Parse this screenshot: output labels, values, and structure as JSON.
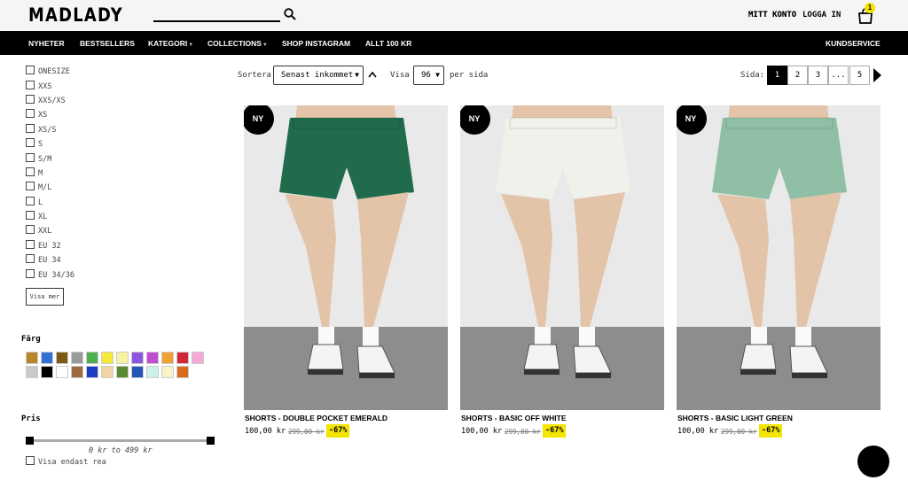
{
  "header": {
    "logo": "MADLADY",
    "account": "MITT KONTO",
    "login": "LOGGA IN",
    "cart_count": "1"
  },
  "nav": {
    "items": [
      "NYHETER",
      "BESTSELLERS",
      "KATEGORI",
      "COLLECTIONS",
      "SHOP INSTAGRAM",
      "ALLT 100 KR"
    ],
    "service": "KUNDSERVICE"
  },
  "sidebar": {
    "sizes": [
      "ONESIZE",
      "XXS",
      "XXS/XS",
      "XS",
      "XS/S",
      "S",
      "S/M",
      "M",
      "M/L",
      "L",
      "XL",
      "XXL",
      "EU 32",
      "EU 34",
      "EU 34/36"
    ],
    "more": "Visa mer",
    "color_heading": "Färg",
    "colors": [
      "#b8862b",
      "#2f6fd6",
      "#7a5a12",
      "#9a9a9a",
      "#4caf50",
      "#f5ea3a",
      "#f7f2a0",
      "#8b55e0",
      "#c04ccf",
      "#f0a133",
      "#d2283c",
      "#f5a8d8",
      "#c9c9c9",
      "#000000",
      "#ffffff",
      "#a06a40",
      "#1c3cc4",
      "#f2d3a8",
      "#5a8a2e",
      "#2354b8",
      "#c9f3e8",
      "#f6f4c8",
      "#d86a1c"
    ],
    "price_heading": "Pris",
    "price_range": "0 kr to 499 kr",
    "rea": "Visa endast rea"
  },
  "toolbar": {
    "sort_label": "Sortera",
    "sort_value": "Senast inkommet",
    "show_label": "Visa",
    "show_value": "96",
    "per_page": "per sida",
    "page_label": "Sida:",
    "pages": [
      "1",
      "2",
      "3",
      "...",
      "5"
    ]
  },
  "products": [
    {
      "badge": "NY",
      "name": "SHORTS - DOUBLE POCKET EMERALD",
      "price": "100,00 kr",
      "old_price": "299,00 kr",
      "discount": "-67%",
      "color": "#1f6b4c"
    },
    {
      "badge": "NY",
      "name": "SHORTS - BASIC OFF WHITE",
      "price": "100,00 kr",
      "old_price": "299,00 kr",
      "discount": "-67%",
      "color": "#f1f1ec"
    },
    {
      "badge": "NY",
      "name": "SHORTS - BASIC LIGHT GREEN",
      "price": "100,00 kr",
      "old_price": "299,00 kr",
      "discount": "-67%",
      "color": "#8fbfa5"
    }
  ]
}
